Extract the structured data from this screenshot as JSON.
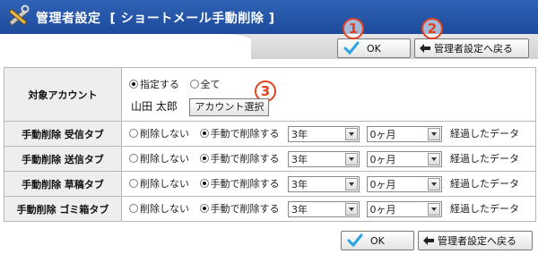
{
  "header": {
    "title": "管理者設定",
    "subtitle": "[ ショートメール手動削除 ]",
    "icon": "tools-icon"
  },
  "toolbar": {
    "ok_label": "OK",
    "back_label": "管理者設定へ戻る"
  },
  "markers": [
    "1",
    "2",
    "3"
  ],
  "target_account": {
    "label": "対象アカウント",
    "option_specify": "指定する",
    "option_all": "全て",
    "selected": "指定する",
    "account_name": "山田 太郎",
    "select_button": "アカウント選択"
  },
  "rows": [
    {
      "label": "手動削除 受信タブ",
      "option_none": "削除しない",
      "option_manual": "手動で削除する",
      "years": "3年",
      "months": "0ヶ月",
      "suffix": "経過したデータ"
    },
    {
      "label": "手動削除 送信タブ",
      "option_none": "削除しない",
      "option_manual": "手動で削除する",
      "years": "3年",
      "months": "0ヶ月",
      "suffix": "経過したデータ"
    },
    {
      "label": "手動削除 草稿タブ",
      "option_none": "削除しない",
      "option_manual": "手動で削除する",
      "years": "3年",
      "months": "0ヶ月",
      "suffix": "経過したデータ"
    },
    {
      "label": "手動削除 ゴミ箱タブ",
      "option_none": "削除しない",
      "option_manual": "手動で削除する",
      "years": "3年",
      "months": "0ヶ月",
      "suffix": "経過したデータ"
    }
  ],
  "colors": {
    "header_bg": "#2458ad",
    "marker": "#e0411e",
    "label_bg": "#eeeeee"
  }
}
